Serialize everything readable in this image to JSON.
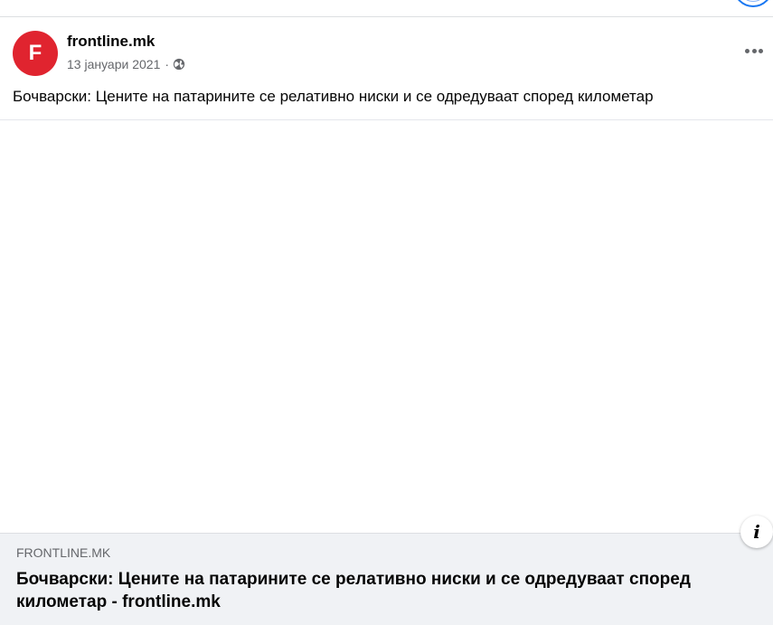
{
  "post": {
    "page_name": "frontline.mk",
    "avatar_letter": "F",
    "date": "13 јануари 2021",
    "separator": "·",
    "privacy_icon": "globe-icon",
    "more_icon": "more-options-icon",
    "text": "Бочварски: Цените на патарините се релативно ниски и се одредуваат според километар"
  },
  "link_preview": {
    "domain": "FRONTLINE.MK",
    "title": "Бочварски: Цените на патарините се релативно ниски и се одредуваат според километар - frontline.mk",
    "info_icon": "info-icon"
  },
  "colors": {
    "avatar_bg": "#e0242f",
    "accent": "#1877f2",
    "preview_bg": "#f0f2f5",
    "secondary_text": "#65676b"
  }
}
